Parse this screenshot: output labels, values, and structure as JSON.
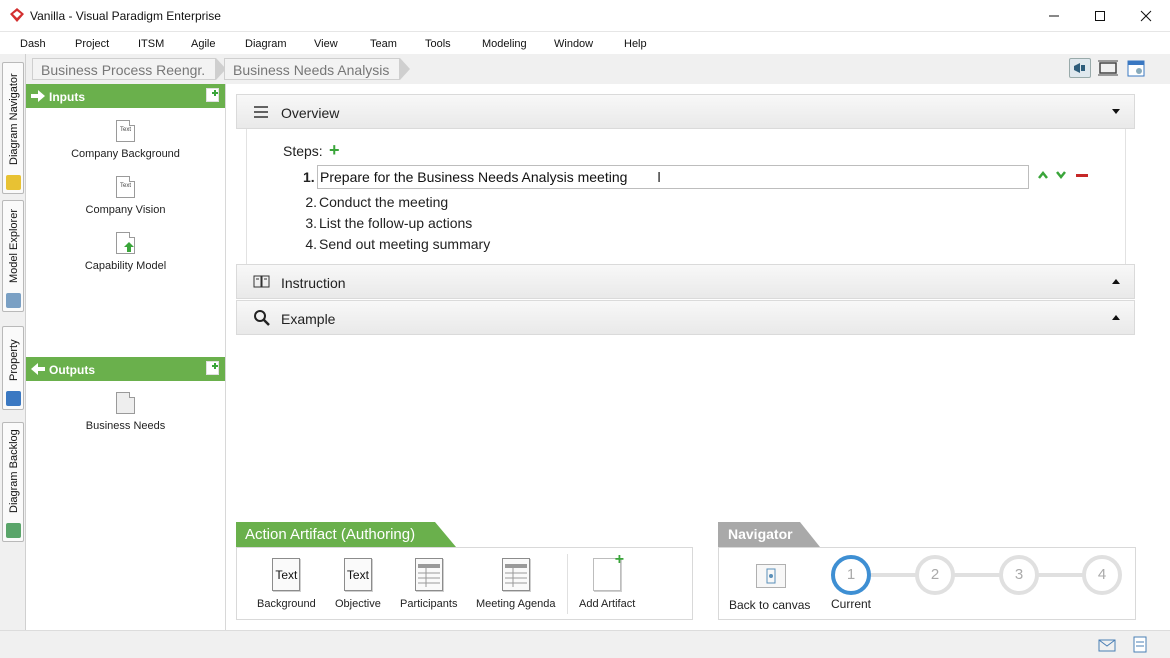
{
  "window": {
    "title": "Vanilla - Visual Paradigm Enterprise",
    "app_icon": "visual-paradigm-logo-icon",
    "controls": [
      "minimize-icon",
      "maximize-icon",
      "close-icon"
    ]
  },
  "menu": [
    "Dash",
    "Project",
    "ITSM",
    "Agile",
    "Diagram",
    "View",
    "Team",
    "Tools",
    "Modeling",
    "Window",
    "Help"
  ],
  "side_tabs": [
    {
      "label": "Diagram Navigator",
      "icon": "diagram-navigator-icon"
    },
    {
      "label": "Model Explorer",
      "icon": "model-explorer-icon"
    },
    {
      "label": "Property",
      "icon": "property-icon"
    },
    {
      "label": "Diagram Backlog",
      "icon": "diagram-backlog-icon"
    }
  ],
  "breadcrumb": [
    "Business Process Reengr.",
    "Business Needs Analysis"
  ],
  "toolbar_icons": [
    "megaphone-icon",
    "fit-diagram-icon",
    "diagram-properties-icon"
  ],
  "inputs": {
    "title": "Inputs",
    "items": [
      {
        "label": "Company Background",
        "icon_text": "Text"
      },
      {
        "label": "Company Vision",
        "icon_text": "Text"
      },
      {
        "label": "Capability Model",
        "icon_text": ""
      }
    ]
  },
  "outputs": {
    "title": "Outputs",
    "items": [
      {
        "label": "Business Needs"
      }
    ]
  },
  "overview": {
    "title": "Overview",
    "steps_label": "Steps:",
    "steps": [
      {
        "num": "1.",
        "text": "Prepare for the Business Needs Analysis meeting"
      },
      {
        "num": "2.",
        "text": "Conduct the meeting"
      },
      {
        "num": "3.",
        "text": "List the follow-up actions"
      },
      {
        "num": "4.",
        "text": "Send out meeting summary"
      }
    ]
  },
  "instruction": {
    "title": "Instruction"
  },
  "example": {
    "title": "Example"
  },
  "action_artifact": {
    "title": "Action Artifact (Authoring)",
    "items": [
      {
        "label": "Background",
        "icon_text": "Text"
      },
      {
        "label": "Objective",
        "icon_text": "Text"
      },
      {
        "label": "Participants",
        "icon_text": ""
      },
      {
        "label": "Meeting Agenda",
        "icon_text": ""
      },
      {
        "label": "Add Artifact",
        "icon_text": ""
      }
    ]
  },
  "navigator": {
    "title": "Navigator",
    "back_label": "Back to canvas",
    "steps": [
      "1",
      "2",
      "3",
      "4"
    ],
    "current_label": "Current",
    "current_color": "#3e8fd3"
  },
  "colors": {
    "accent_green": "#6ab04c",
    "navigator_gray": "#a9a9a9",
    "remove_red": "#c62828"
  }
}
